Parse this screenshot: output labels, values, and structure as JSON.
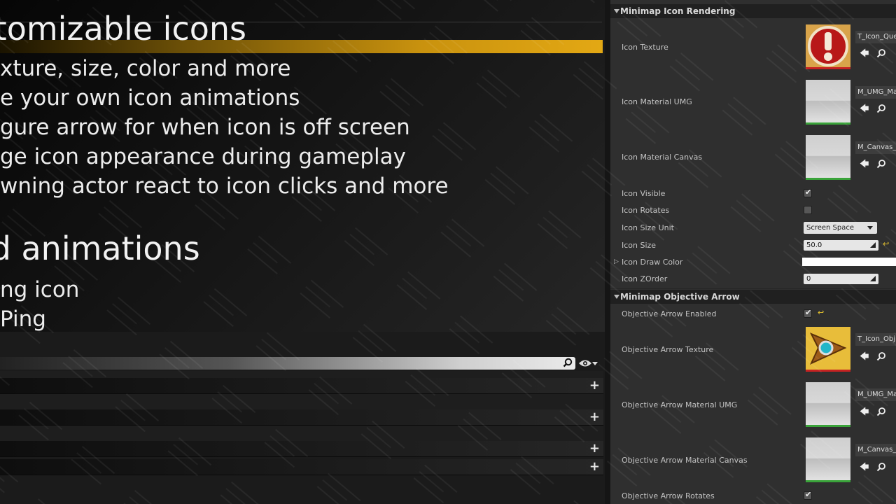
{
  "slide": {
    "heading1": "tomizable icons",
    "bullets1": [
      "xture, size, color and more",
      "e your own icon animations",
      "gure arrow for when icon is off screen",
      "ge icon appearance during gameplay",
      "wning actor react to icon clicks and more"
    ],
    "heading2": "uded animations",
    "bullets2": [
      "ng icon",
      "Ping"
    ]
  },
  "lower_panel": {
    "rows": 4
  },
  "details": {
    "section1": "Minimap Icon Rendering",
    "icon_texture_label": "Icon Texture",
    "icon_texture_asset": "T_Icon_Que",
    "icon_material_umg_label": "Icon Material UMG",
    "icon_material_umg_asset": "M_UMG_Ma",
    "icon_material_canvas_label": "Icon Material Canvas",
    "icon_material_canvas_asset": "M_Canvas_",
    "icon_visible_label": "Icon Visible",
    "icon_visible": true,
    "icon_rotates_label": "Icon Rotates",
    "icon_rotates": false,
    "icon_size_unit_label": "Icon Size Unit",
    "icon_size_unit_value": "Screen Space",
    "icon_size_label": "Icon Size",
    "icon_size_value": "50.0",
    "icon_draw_color_label": "Icon Draw Color",
    "icon_draw_color": "#ffffff",
    "icon_zorder_label": "Icon ZOrder",
    "icon_zorder_value": "0",
    "section2": "Minimap Objective Arrow",
    "arrow_enabled_label": "Objective Arrow Enabled",
    "arrow_enabled": true,
    "arrow_texture_label": "Objective Arrow Texture",
    "arrow_texture_asset": "T_Icon_Obj",
    "arrow_material_umg_label": "Objective Arrow Material UMG",
    "arrow_material_umg_asset": "M_UMG_Ma",
    "arrow_material_canvas_label": "Objective Arrow Material Canvas",
    "arrow_material_canvas_asset": "M_Canvas_",
    "arrow_rotates_label": "Objective Arrow Rotates",
    "arrow_rotates": true
  },
  "colors": {
    "accent_gold": "#e3a814",
    "panel_bg": "#2f2f2f",
    "reset_yellow": "#e7c42e",
    "thumb_border_green": "#3aa33a",
    "thumb_border_red": "#c62222"
  }
}
